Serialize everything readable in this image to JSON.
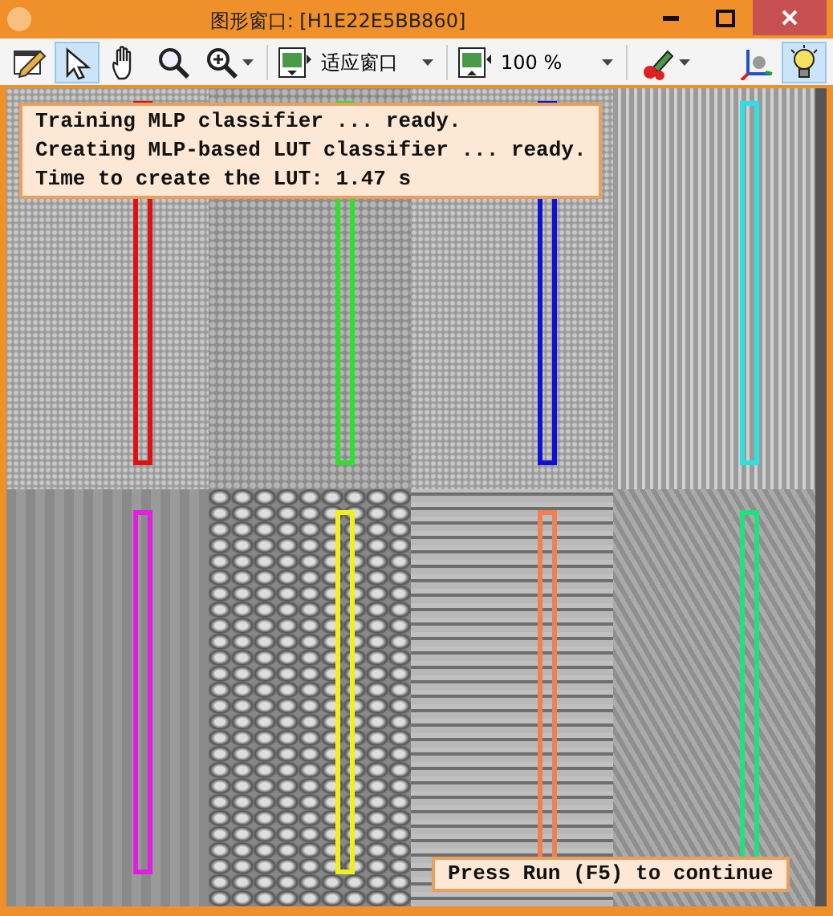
{
  "window": {
    "title": "图形窗口: [H1E22E5BB860]"
  },
  "toolbar": [
    {
      "kind": "button",
      "selected": false
    },
    {
      "kind": "button",
      "selected": true
    },
    {
      "kind": "button",
      "selected": false
    },
    {
      "kind": "button",
      "selected": false
    },
    {
      "kind": "menu",
      "selected": false
    },
    {
      "kind": "separator"
    },
    {
      "kind": "combo",
      "label": "适应窗口"
    },
    {
      "kind": "separator"
    },
    {
      "kind": "combo",
      "label": "100 %"
    },
    {
      "kind": "separator"
    },
    {
      "kind": "menu",
      "selected": false
    },
    {
      "kind": "spacer"
    },
    {
      "kind": "button",
      "selected": false
    },
    {
      "kind": "button",
      "selected": true
    }
  ],
  "canvas": {
    "tiles": [
      {
        "kind": "fine",
        "color": "#e01010"
      },
      {
        "kind": "mottled",
        "color": "#30e030"
      },
      {
        "kind": "fine",
        "color": "#1010d0"
      },
      {
        "kind": "striped",
        "color": "#30e0e0"
      },
      {
        "kind": "flat",
        "color": "#e020e0"
      },
      {
        "kind": "rough",
        "color": "#f0f020"
      },
      {
        "kind": "lined",
        "color": "#f08050"
      },
      {
        "kind": "woven",
        "color": "#20e080"
      }
    ],
    "message": {
      "lines": [
        "Training MLP classifier ... ready.",
        "Creating MLP-based LUT classifier ... ready.",
        "Time to create the LUT: 1.47 s"
      ]
    },
    "continue_message": "Press Run (F5) to continue"
  }
}
